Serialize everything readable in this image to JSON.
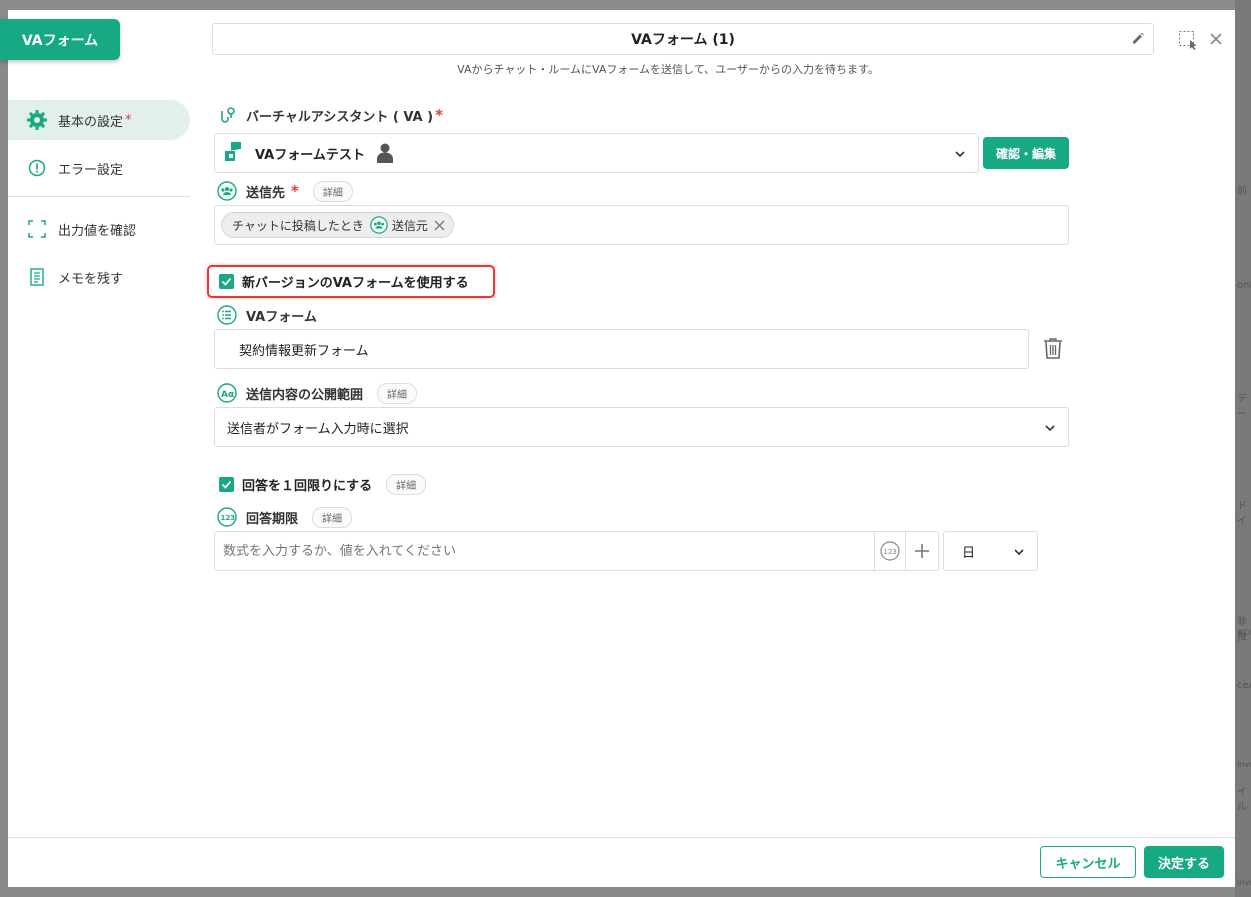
{
  "header": {
    "tag_label": "VAフォーム",
    "title": "VAフォーム (1)",
    "subtitle": "VAからチャット・ルームにVAフォームを送信して、ユーザーからの入力を待ちます。"
  },
  "sidebar": {
    "items": [
      {
        "label": "基本の設定",
        "required": "*"
      },
      {
        "label": "エラー設定"
      },
      {
        "label": "出力値を確認"
      },
      {
        "label": "メモを残す"
      }
    ]
  },
  "va": {
    "label": "バーチャルアシスタント ( VA )",
    "required": "*",
    "selected": "VAフォームテスト",
    "edit_button": "確認・編集"
  },
  "recipient": {
    "label": "送信先",
    "required": "*",
    "detail": "詳細",
    "chip_text": "チャットに投稿したとき",
    "chip_sub": "送信元"
  },
  "new_version": {
    "label": "新バージョンのVAフォームを使用する",
    "checked": true
  },
  "form": {
    "label": "VAフォーム",
    "value": "契約情報更新フォーム"
  },
  "visibility": {
    "label": "送信内容の公開範囲",
    "detail": "詳細",
    "value": "送信者がフォーム入力時に選択"
  },
  "once": {
    "label": "回答を１回限りにする",
    "detail": "詳細",
    "checked": true
  },
  "deadline": {
    "label": "回答期限",
    "detail": "詳細",
    "placeholder": "数式を入力するか、値を入れてください",
    "unit": "日"
  },
  "footer": {
    "cancel": "キャンセル",
    "ok": "決定する"
  },
  "background_fragments": [
    "前",
    "onE",
    "デー",
    "ドイ",
    "非推",
    "xce",
    "ceA",
    "Invo",
    "イル",
    "Invo"
  ],
  "colors": {
    "accent": "#17a984",
    "required": "#e53935",
    "highlight_border": "#e53935"
  }
}
